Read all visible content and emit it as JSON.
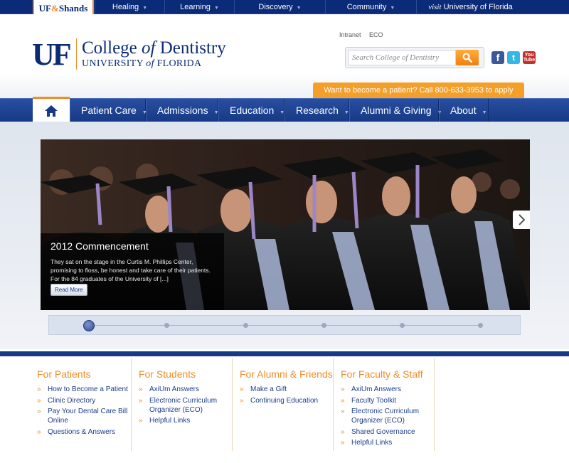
{
  "topbar": {
    "logo": {
      "part1": "UF",
      "amp": "&",
      "part2": "Shands"
    },
    "items": [
      {
        "label": "Healing"
      },
      {
        "label": "Learning"
      },
      {
        "label": "Discovery"
      },
      {
        "label": "Community"
      }
    ],
    "visit": {
      "prefix": "visit",
      "label": "University of Florida"
    },
    "caret": "▼"
  },
  "header": {
    "uf": "UF",
    "college_a": "College ",
    "college_of": "of",
    "college_b": " Dentistry",
    "uni_a": "UNIVERSITY ",
    "uni_of": "of",
    "uni_b": " FLORIDA",
    "links": {
      "intranet": "Intranet",
      "eco": "ECO"
    },
    "search_placeholder": "Search College of Dentistry",
    "social": {
      "facebook": "f",
      "twitter": "t",
      "youtube_a": "You",
      "youtube_b": "Tube"
    },
    "cta": "Want to become a patient? Call 800-633-3953 to apply"
  },
  "nav": {
    "items": [
      {
        "label": "Patient Care"
      },
      {
        "label": "Admissions"
      },
      {
        "label": "Education"
      },
      {
        "label": "Research"
      },
      {
        "label": "Alumni & Giving"
      },
      {
        "label": "About"
      }
    ]
  },
  "hero": {
    "title": "2012 Commencement",
    "text": "They sat on the stage in the Curtis M. Phillips Center, promising to floss, be honest and take care of their patients. For the 84 graduates of the University of [...]",
    "read_more": "Read More",
    "slide_count": 6,
    "active_slide": 1
  },
  "footer": {
    "chevron": "»",
    "columns": [
      {
        "title": "For Patients",
        "links": [
          "How to Become a Patient",
          "Clinic Directory",
          "Pay Your Dental Care Bill Online",
          "Questions & Answers"
        ]
      },
      {
        "title": "For Students",
        "links": [
          "AxiUm Answers",
          "Electronic Curriculum Organizer (ECO)",
          "Helpful Links"
        ]
      },
      {
        "title": "For Alumni & Friends",
        "links": [
          "Make a Gift",
          "Continuing Education"
        ]
      },
      {
        "title": "For Faculty & Staff",
        "links": [
          "AxiUm Answers",
          "Faculty Toolkit",
          "Electronic Curriculum Organizer (ECO)",
          "Shared Governance",
          "Helpful Links"
        ]
      }
    ]
  },
  "colors": {
    "navy": "#0b2b78",
    "orange": "#f28c28",
    "nav_blue": "#1f4594"
  }
}
